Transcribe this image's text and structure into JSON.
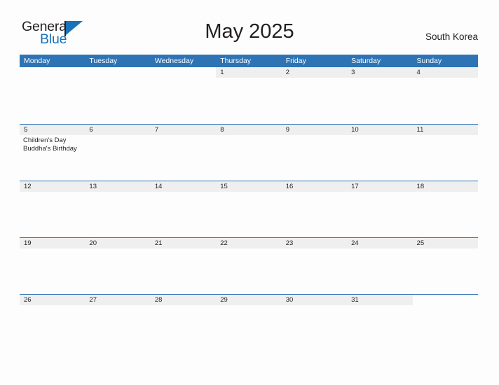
{
  "logo": {
    "word_one": "General",
    "word_two": "Blue",
    "flag_icon": "flag-triangle-icon",
    "accent_color": "#1a72b8"
  },
  "header": {
    "title": "May 2025",
    "location": "South Korea"
  },
  "theme": {
    "header_blue": "#2e74b5",
    "band_gray": "#efefef",
    "text_color": "#231f20",
    "page_background": "#fdfdfd"
  },
  "calendar": {
    "weekdays": [
      "Monday",
      "Tuesday",
      "Wednesday",
      "Thursday",
      "Friday",
      "Saturday",
      "Sunday"
    ],
    "weeks": [
      [
        {
          "date": "",
          "events": [],
          "blank": true
        },
        {
          "date": "",
          "events": [],
          "blank": true
        },
        {
          "date": "",
          "events": [],
          "blank": true
        },
        {
          "date": "1",
          "events": []
        },
        {
          "date": "2",
          "events": []
        },
        {
          "date": "3",
          "events": []
        },
        {
          "date": "4",
          "events": []
        }
      ],
      [
        {
          "date": "5",
          "events": [
            "Children's Day",
            "Buddha's Birthday"
          ]
        },
        {
          "date": "6",
          "events": []
        },
        {
          "date": "7",
          "events": []
        },
        {
          "date": "8",
          "events": []
        },
        {
          "date": "9",
          "events": []
        },
        {
          "date": "10",
          "events": []
        },
        {
          "date": "11",
          "events": []
        }
      ],
      [
        {
          "date": "12",
          "events": []
        },
        {
          "date": "13",
          "events": []
        },
        {
          "date": "14",
          "events": []
        },
        {
          "date": "15",
          "events": []
        },
        {
          "date": "16",
          "events": []
        },
        {
          "date": "17",
          "events": []
        },
        {
          "date": "18",
          "events": []
        }
      ],
      [
        {
          "date": "19",
          "events": []
        },
        {
          "date": "20",
          "events": []
        },
        {
          "date": "21",
          "events": []
        },
        {
          "date": "22",
          "events": []
        },
        {
          "date": "23",
          "events": []
        },
        {
          "date": "24",
          "events": []
        },
        {
          "date": "25",
          "events": []
        }
      ],
      [
        {
          "date": "26",
          "events": []
        },
        {
          "date": "27",
          "events": []
        },
        {
          "date": "28",
          "events": []
        },
        {
          "date": "29",
          "events": []
        },
        {
          "date": "30",
          "events": []
        },
        {
          "date": "31",
          "events": []
        },
        {
          "date": "",
          "events": [],
          "blank": true
        }
      ]
    ]
  }
}
